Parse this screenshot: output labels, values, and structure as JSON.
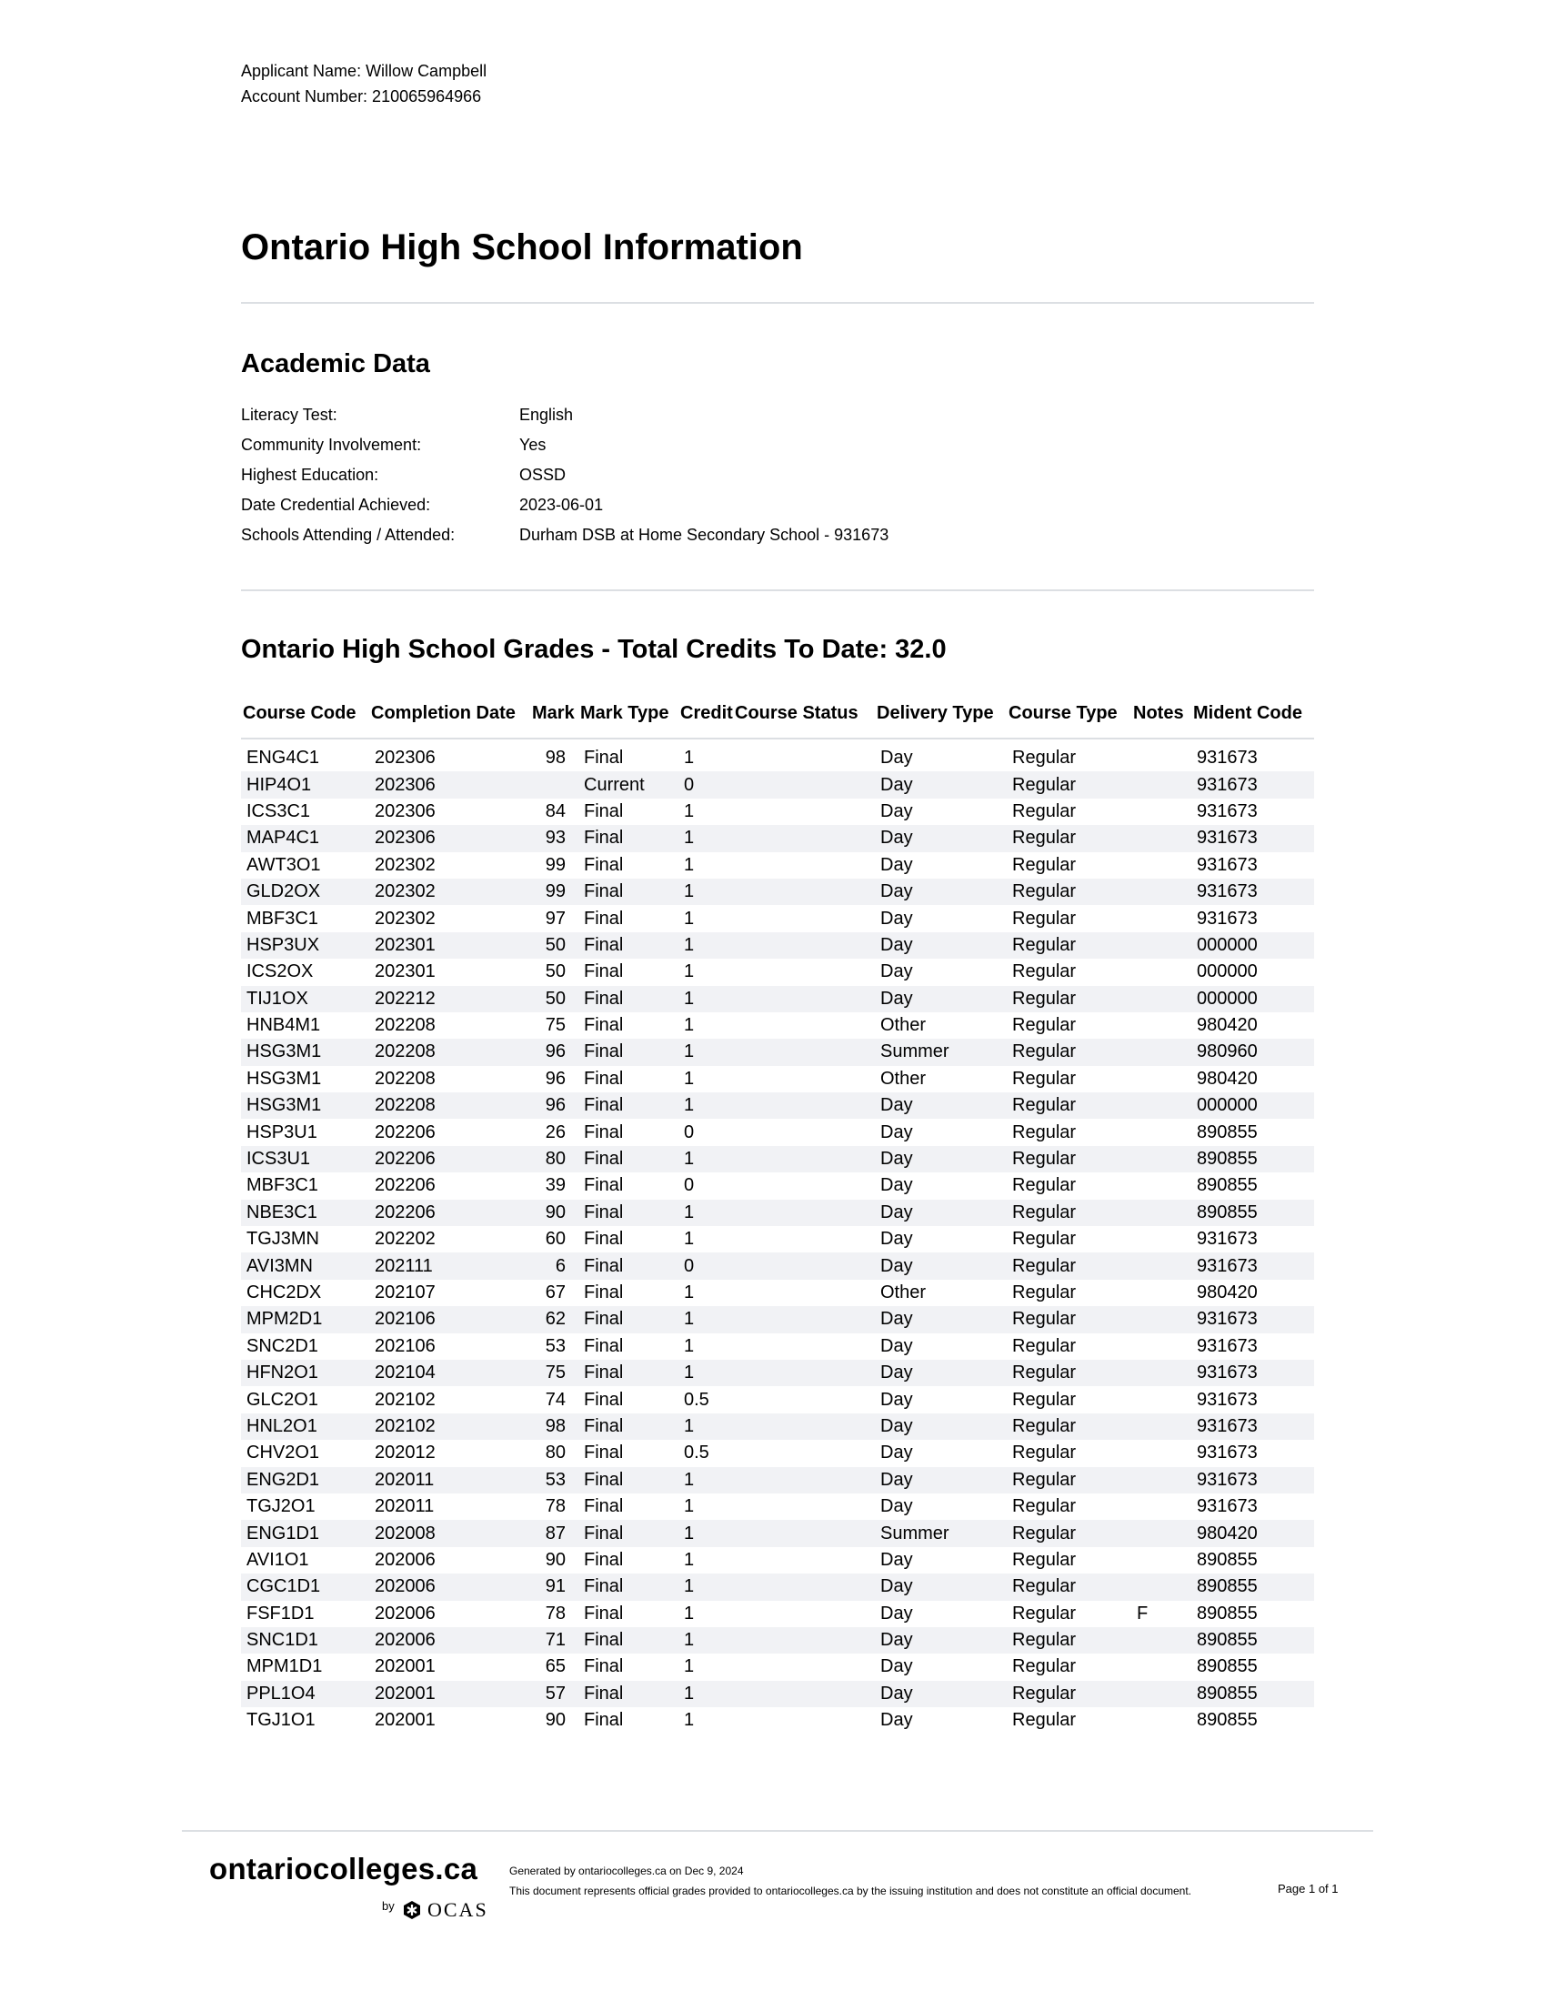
{
  "applicant": {
    "name_line": "Applicant Name: Willow Campbell",
    "account_line": "Account Number: 210065964966"
  },
  "title": "Ontario High School Information",
  "academic": {
    "heading": "Academic Data",
    "rows": [
      {
        "label": "Literacy Test:",
        "value": "English"
      },
      {
        "label": "Community Involvement:",
        "value": "Yes"
      },
      {
        "label": "Highest Education:",
        "value": "OSSD"
      },
      {
        "label": "Date Credential Achieved:",
        "value": "2023-06-01"
      },
      {
        "label": "Schools Attending / Attended:",
        "value": "Durham DSB at Home Secondary School - 931673"
      }
    ]
  },
  "grades": {
    "heading": "Ontario High School Grades - Total Credits To Date: 32.0",
    "columns": [
      "Course Code",
      "Completion Date",
      "Mark",
      "Mark Type",
      "Credit",
      "Course Status",
      "Delivery Type",
      "Course Type",
      "Notes",
      "Mident Code"
    ],
    "rows": [
      [
        "ENG4C1",
        "202306",
        "98",
        "Final",
        "1",
        "",
        "Day",
        "Regular",
        "",
        "931673"
      ],
      [
        "HIP4O1",
        "202306",
        "",
        "Current",
        "0",
        "",
        "Day",
        "Regular",
        "",
        "931673"
      ],
      [
        "ICS3C1",
        "202306",
        "84",
        "Final",
        "1",
        "",
        "Day",
        "Regular",
        "",
        "931673"
      ],
      [
        "MAP4C1",
        "202306",
        "93",
        "Final",
        "1",
        "",
        "Day",
        "Regular",
        "",
        "931673"
      ],
      [
        "AWT3O1",
        "202302",
        "99",
        "Final",
        "1",
        "",
        "Day",
        "Regular",
        "",
        "931673"
      ],
      [
        "GLD2OX",
        "202302",
        "99",
        "Final",
        "1",
        "",
        "Day",
        "Regular",
        "",
        "931673"
      ],
      [
        "MBF3C1",
        "202302",
        "97",
        "Final",
        "1",
        "",
        "Day",
        "Regular",
        "",
        "931673"
      ],
      [
        "HSP3UX",
        "202301",
        "50",
        "Final",
        "1",
        "",
        "Day",
        "Regular",
        "",
        "000000"
      ],
      [
        "ICS2OX",
        "202301",
        "50",
        "Final",
        "1",
        "",
        "Day",
        "Regular",
        "",
        "000000"
      ],
      [
        "TIJ1OX",
        "202212",
        "50",
        "Final",
        "1",
        "",
        "Day",
        "Regular",
        "",
        "000000"
      ],
      [
        "HNB4M1",
        "202208",
        "75",
        "Final",
        "1",
        "",
        "Other",
        "Regular",
        "",
        "980420"
      ],
      [
        "HSG3M1",
        "202208",
        "96",
        "Final",
        "1",
        "",
        "Summer",
        "Regular",
        "",
        "980960"
      ],
      [
        "HSG3M1",
        "202208",
        "96",
        "Final",
        "1",
        "",
        "Other",
        "Regular",
        "",
        "980420"
      ],
      [
        "HSG3M1",
        "202208",
        "96",
        "Final",
        "1",
        "",
        "Day",
        "Regular",
        "",
        "000000"
      ],
      [
        "HSP3U1",
        "202206",
        "26",
        "Final",
        "0",
        "",
        "Day",
        "Regular",
        "",
        "890855"
      ],
      [
        "ICS3U1",
        "202206",
        "80",
        "Final",
        "1",
        "",
        "Day",
        "Regular",
        "",
        "890855"
      ],
      [
        "MBF3C1",
        "202206",
        "39",
        "Final",
        "0",
        "",
        "Day",
        "Regular",
        "",
        "890855"
      ],
      [
        "NBE3C1",
        "202206",
        "90",
        "Final",
        "1",
        "",
        "Day",
        "Regular",
        "",
        "890855"
      ],
      [
        "TGJ3MN",
        "202202",
        "60",
        "Final",
        "1",
        "",
        "Day",
        "Regular",
        "",
        "931673"
      ],
      [
        "AVI3MN",
        "202111",
        "6",
        "Final",
        "0",
        "",
        "Day",
        "Regular",
        "",
        "931673"
      ],
      [
        "CHC2DX",
        "202107",
        "67",
        "Final",
        "1",
        "",
        "Other",
        "Regular",
        "",
        "980420"
      ],
      [
        "MPM2D1",
        "202106",
        "62",
        "Final",
        "1",
        "",
        "Day",
        "Regular",
        "",
        "931673"
      ],
      [
        "SNC2D1",
        "202106",
        "53",
        "Final",
        "1",
        "",
        "Day",
        "Regular",
        "",
        "931673"
      ],
      [
        "HFN2O1",
        "202104",
        "75",
        "Final",
        "1",
        "",
        "Day",
        "Regular",
        "",
        "931673"
      ],
      [
        "GLC2O1",
        "202102",
        "74",
        "Final",
        "0.5",
        "",
        "Day",
        "Regular",
        "",
        "931673"
      ],
      [
        "HNL2O1",
        "202102",
        "98",
        "Final",
        "1",
        "",
        "Day",
        "Regular",
        "",
        "931673"
      ],
      [
        "CHV2O1",
        "202012",
        "80",
        "Final",
        "0.5",
        "",
        "Day",
        "Regular",
        "",
        "931673"
      ],
      [
        "ENG2D1",
        "202011",
        "53",
        "Final",
        "1",
        "",
        "Day",
        "Regular",
        "",
        "931673"
      ],
      [
        "TGJ2O1",
        "202011",
        "78",
        "Final",
        "1",
        "",
        "Day",
        "Regular",
        "",
        "931673"
      ],
      [
        "ENG1D1",
        "202008",
        "87",
        "Final",
        "1",
        "",
        "Summer",
        "Regular",
        "",
        "980420"
      ],
      [
        "AVI1O1",
        "202006",
        "90",
        "Final",
        "1",
        "",
        "Day",
        "Regular",
        "",
        "890855"
      ],
      [
        "CGC1D1",
        "202006",
        "91",
        "Final",
        "1",
        "",
        "Day",
        "Regular",
        "",
        "890855"
      ],
      [
        "FSF1D1",
        "202006",
        "78",
        "Final",
        "1",
        "",
        "Day",
        "Regular",
        "F",
        "890855"
      ],
      [
        "SNC1D1",
        "202006",
        "71",
        "Final",
        "1",
        "",
        "Day",
        "Regular",
        "",
        "890855"
      ],
      [
        "MPM1D1",
        "202001",
        "65",
        "Final",
        "1",
        "",
        "Day",
        "Regular",
        "",
        "890855"
      ],
      [
        "PPL1O4",
        "202001",
        "57",
        "Final",
        "1",
        "",
        "Day",
        "Regular",
        "",
        "890855"
      ],
      [
        "TGJ1O1",
        "202001",
        "90",
        "Final",
        "1",
        "",
        "Day",
        "Regular",
        "",
        "890855"
      ]
    ]
  },
  "footer": {
    "logo_text": "ontariocolleges.ca",
    "byline": "by",
    "ocas_text": "OCAS",
    "generated": "Generated by ontariocolleges.ca on Dec 9, 2024",
    "disclaimer": "This document represents official grades provided to ontariocolleges.ca by the issuing institution and does not constitute an official document.",
    "page": "Page 1 of 1"
  }
}
